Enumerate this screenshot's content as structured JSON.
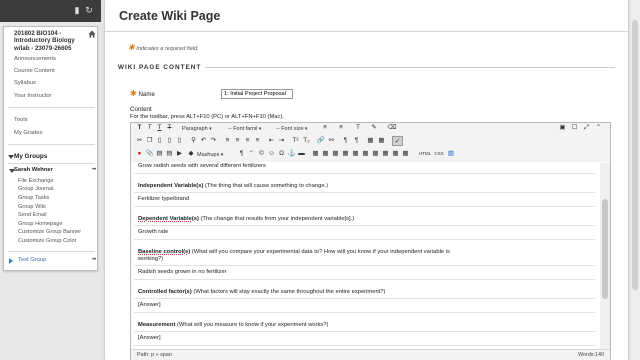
{
  "nav": {
    "course_title": "201802 BIO104 - Introductory Biology w/lab - 23079-26605",
    "links": [
      "Announcements",
      "Course Content",
      "Syllabus",
      "Your Instructor"
    ],
    "links2": [
      "Tools",
      "My Grades"
    ],
    "my_groups": "My Groups",
    "user_name": "Sarah Wehner",
    "group_links": [
      "File Exchange",
      "Group Journal",
      "Group Tasks",
      "Group Wiki",
      "Send Email",
      "Group Homepage",
      "Customize Group Banner",
      "Customize Group Color"
    ],
    "test_group": "Test Group",
    "dots": "•••"
  },
  "page": {
    "title": "Create Wiki Page",
    "required_note": "Indicates a required field.",
    "section_title": "WIKI PAGE CONTENT",
    "name_label": "Name",
    "name_value": "1: Initial Project Proposal",
    "content_label": "Content",
    "toolbar_hint": "For the toolbar, press ALT+F10 (PC) or ALT+FN+F10 (Mac)."
  },
  "toolbar": {
    "paragraph": "Paragraph",
    "font_family": "-- Font famil",
    "font_size": "-- Font size",
    "mashups": "Mashups",
    "html_label": "HTML",
    "css_label": "CSS"
  },
  "editor": {
    "top_partial": "Grow radish seeds with several different fertilizers",
    "blocks": [
      {
        "heading": "Independent Variable(s)",
        "desc": " (The thing that will cause something to change.)",
        "answer": "Fertilizer type/brand"
      },
      {
        "heading": "Dependent Variable(s)",
        "desc": " (The change that results from your independent variable[s].)",
        "answer": "Growth rate"
      },
      {
        "heading": "Baseline control(s)",
        "desc": "  (What will you compare your experimental data to?  How will you know if your independent variable is",
        "desc2": "working?)",
        "answer": "Radish seeds grown in no fertilizer"
      },
      {
        "heading": "Controlled factor(s)",
        "desc": " (What factors will stay exactly the same throughout the entire experiment?)",
        "answer": "[Answer]"
      },
      {
        "heading": "Measurement",
        "desc": " (What will you measure to know if your experiment works?)",
        "answer": "[Answer]"
      }
    ],
    "path": "Path: p » span",
    "words": "Words:140"
  }
}
